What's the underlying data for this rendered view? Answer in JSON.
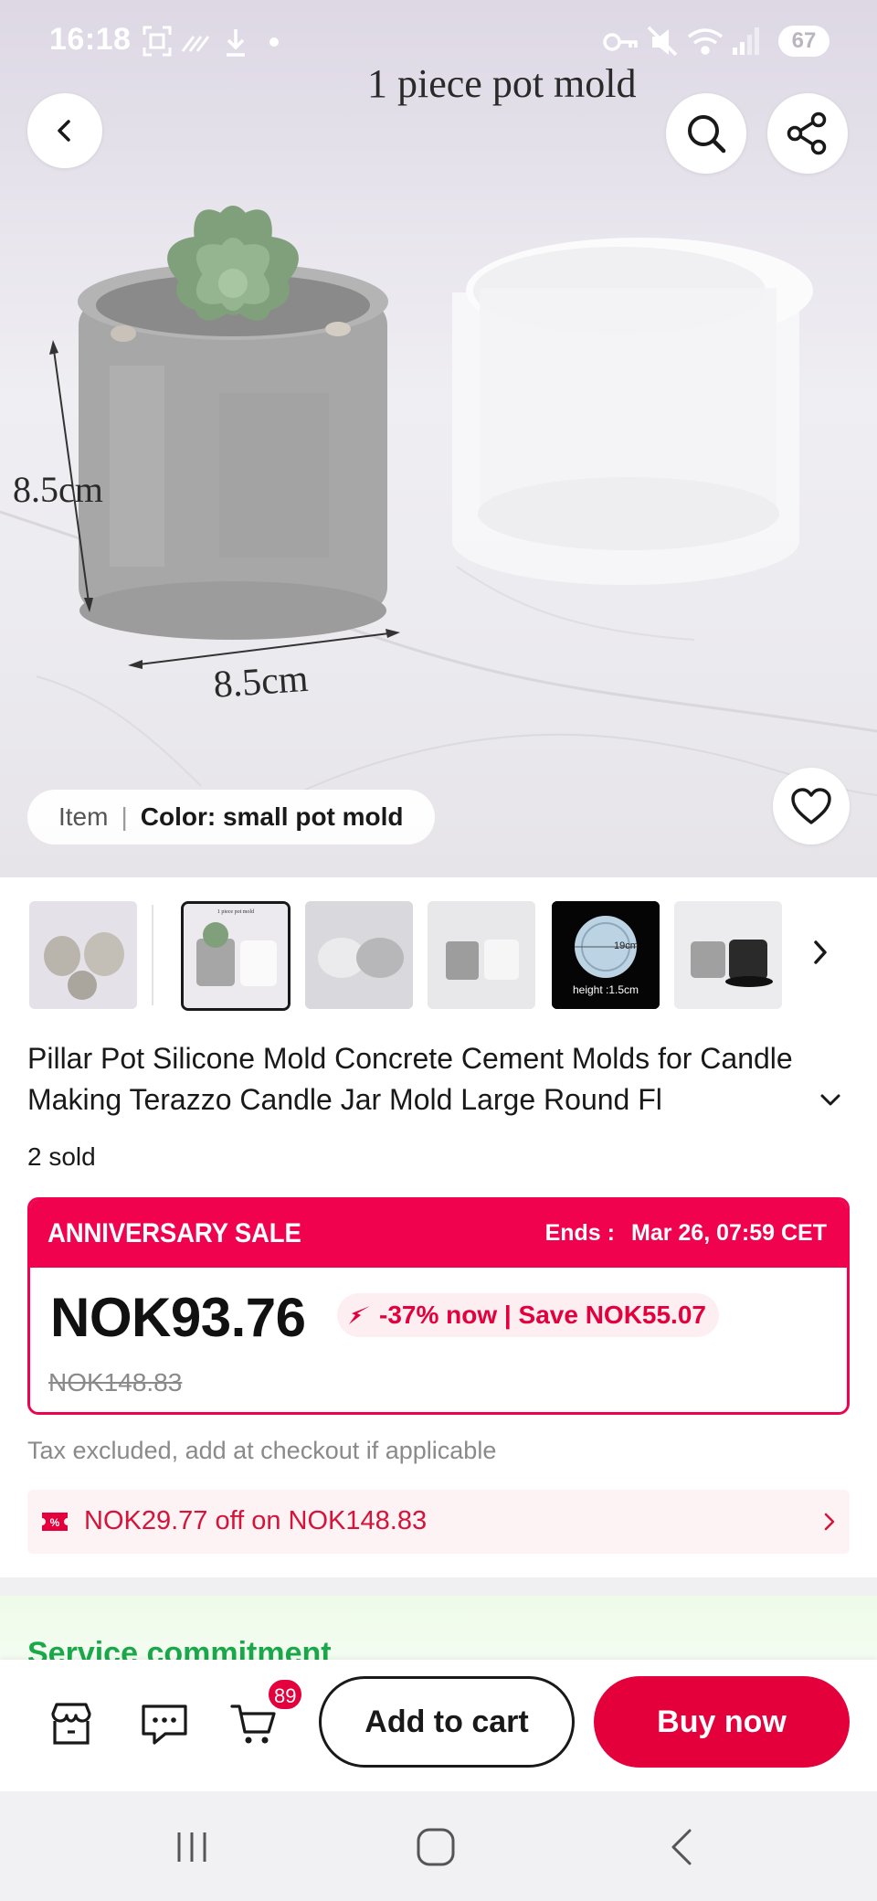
{
  "status_bar": {
    "time": "16:18",
    "battery": "67",
    "icons_left": [
      "screenshot-icon",
      "signal-lines-icon",
      "download-icon",
      "dot-icon"
    ],
    "icons_right": [
      "vpn-key-icon",
      "mute-icon",
      "wifi-icon",
      "cell-signal-icon",
      "battery-icon"
    ]
  },
  "hero": {
    "caption": "1 piece pot mold",
    "dimension_height": "8.5cm",
    "dimension_width": "8.5cm",
    "variant": {
      "item_label": "Item",
      "separator": "|",
      "color_label": "Color: small pot mold"
    }
  },
  "thumbnails": [
    {
      "name": "thumb-item-overview",
      "selected": false
    },
    {
      "name": "thumb-pot-mold",
      "selected": true
    },
    {
      "name": "thumb-lid-mold",
      "selected": false
    },
    {
      "name": "thumb-dimensions",
      "selected": false
    },
    {
      "name": "thumb-base-mold",
      "selected": false,
      "label_size": "19cm",
      "label_height": "height :1.5cm"
    },
    {
      "name": "thumb-black-pots",
      "selected": false
    }
  ],
  "product": {
    "title": "Pillar Pot Silicone Mold Concrete Cement Molds for Candle Making Terazzo Candle Jar Mold Large Round Fl",
    "sold": "2 sold"
  },
  "sale": {
    "name": "ANNIVERSARY SALE",
    "ends_label": "Ends :",
    "ends_value": "Mar 26, 07:59 CET",
    "price": "NOK93.76",
    "discount": "-37% now | Save NOK55.07",
    "original_price": "NOK148.83"
  },
  "tax_note": "Tax excluded, add at checkout if applicable",
  "coupon": {
    "text": "NOK29.77 off on NOK148.83"
  },
  "service": {
    "title": "Service commitment"
  },
  "action_bar": {
    "cart_count": "89",
    "add_to_cart": "Add to cart",
    "buy_now": "Buy now"
  },
  "colors": {
    "brand_red": "#e4003b",
    "sale_pink": "#f0024f",
    "coupon_bg": "#fdf2f4",
    "service_green": "#1aa84a"
  }
}
